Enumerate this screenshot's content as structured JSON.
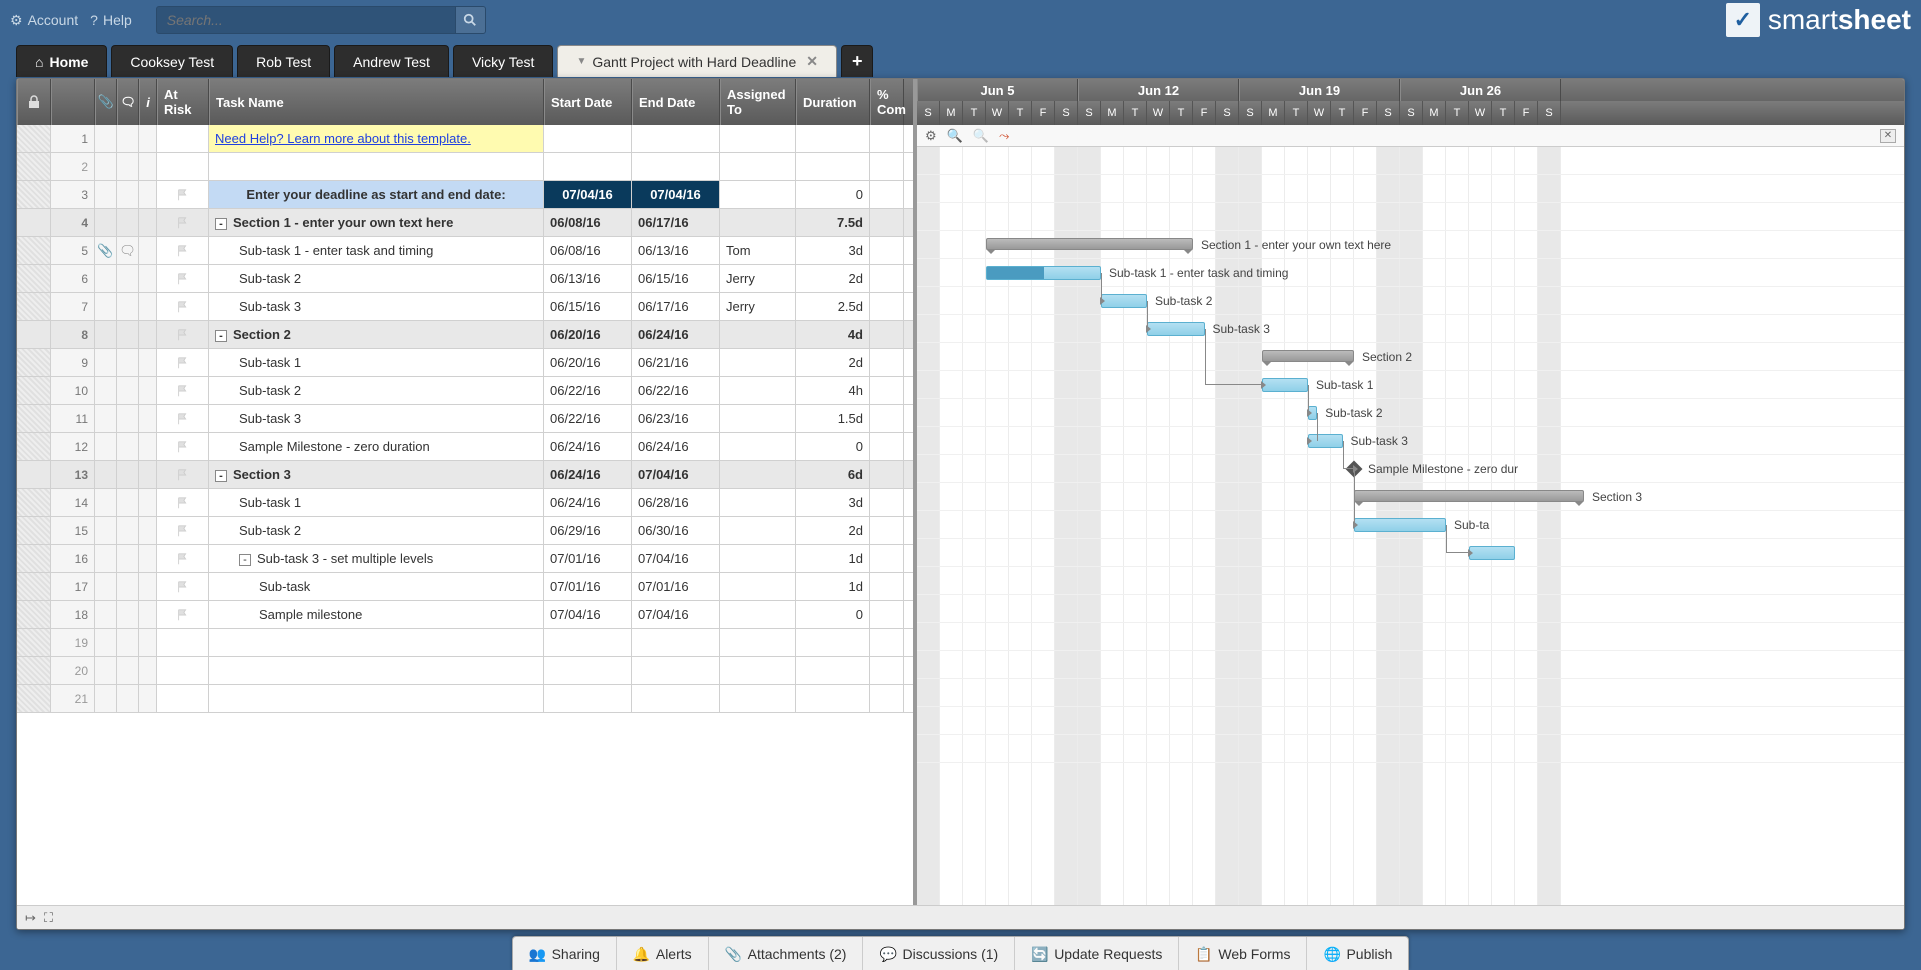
{
  "topbar": {
    "account": "Account",
    "help": "Help",
    "search_placeholder": "Search..."
  },
  "logo": {
    "text1": "smart",
    "text2": "sheet"
  },
  "tabs": {
    "home": "Home",
    "items": [
      "Cooksey Test",
      "Rob Test",
      "Andrew Test",
      "Vicky Test"
    ],
    "active": "Gantt Project with Hard Deadline"
  },
  "columns": {
    "at_risk": "At Risk",
    "task_name": "Task Name",
    "start_date": "Start Date",
    "end_date": "End Date",
    "assigned_to": "Assigned To",
    "duration": "Duration",
    "pct_complete": "% Com"
  },
  "gantt_header": {
    "weeks": [
      "Jun 5",
      "Jun 12",
      "Jun 19",
      "Jun 26"
    ],
    "days": [
      "S",
      "M",
      "T",
      "W",
      "T",
      "F",
      "S"
    ]
  },
  "rows": [
    {
      "num": 1,
      "type": "help",
      "task": "Need Help? Learn more about this template."
    },
    {
      "num": 2,
      "type": "empty"
    },
    {
      "num": 3,
      "type": "deadline",
      "task": "Enter your deadline as start and end date:",
      "start": "07/04/16",
      "end": "07/04/16",
      "duration": "0",
      "flag": true
    },
    {
      "num": 4,
      "type": "section",
      "task": "Section 1 - enter your own text here",
      "start": "06/08/16",
      "end": "06/17/16",
      "duration": "7.5d",
      "expander": "-"
    },
    {
      "num": 5,
      "type": "task",
      "indent": 1,
      "task": "Sub-task 1 - enter task and timing",
      "start": "06/08/16",
      "end": "06/13/16",
      "assigned": "Tom",
      "duration": "3d",
      "flag": true,
      "clip": true,
      "comment": true
    },
    {
      "num": 6,
      "type": "task",
      "indent": 1,
      "task": "Sub-task 2",
      "start": "06/13/16",
      "end": "06/15/16",
      "assigned": "Jerry",
      "duration": "2d",
      "flag": true
    },
    {
      "num": 7,
      "type": "task",
      "indent": 1,
      "task": "Sub-task 3",
      "start": "06/15/16",
      "end": "06/17/16",
      "assigned": "Jerry",
      "duration": "2.5d",
      "flag": true
    },
    {
      "num": 8,
      "type": "section",
      "task": "Section 2",
      "start": "06/20/16",
      "end": "06/24/16",
      "duration": "4d",
      "expander": "-"
    },
    {
      "num": 9,
      "type": "task",
      "indent": 1,
      "task": "Sub-task 1",
      "start": "06/20/16",
      "end": "06/21/16",
      "duration": "2d",
      "flag": true
    },
    {
      "num": 10,
      "type": "task",
      "indent": 1,
      "task": "Sub-task 2",
      "start": "06/22/16",
      "end": "06/22/16",
      "duration": "4h",
      "flag": true
    },
    {
      "num": 11,
      "type": "task",
      "indent": 1,
      "task": "Sub-task 3",
      "start": "06/22/16",
      "end": "06/23/16",
      "duration": "1.5d",
      "flag": true
    },
    {
      "num": 12,
      "type": "task",
      "indent": 1,
      "task": "Sample Milestone - zero duration",
      "start": "06/24/16",
      "end": "06/24/16",
      "duration": "0",
      "flag": true
    },
    {
      "num": 13,
      "type": "section",
      "task": "Section 3",
      "start": "06/24/16",
      "end": "07/04/16",
      "duration": "6d",
      "expander": "-"
    },
    {
      "num": 14,
      "type": "task",
      "indent": 1,
      "task": "Sub-task 1",
      "start": "06/24/16",
      "end": "06/28/16",
      "duration": "3d",
      "flag": true
    },
    {
      "num": 15,
      "type": "task",
      "indent": 1,
      "task": "Sub-task 2",
      "start": "06/29/16",
      "end": "06/30/16",
      "duration": "2d",
      "flag": true
    },
    {
      "num": 16,
      "type": "task",
      "indent": 1,
      "task": "Sub-task 3 - set multiple levels",
      "start": "07/01/16",
      "end": "07/04/16",
      "duration": "1d",
      "flag": true,
      "expander": "-"
    },
    {
      "num": 17,
      "type": "task",
      "indent": 2,
      "task": "Sub-task",
      "start": "07/01/16",
      "end": "07/01/16",
      "duration": "1d",
      "flag": true
    },
    {
      "num": 18,
      "type": "task",
      "indent": 2,
      "task": "Sample milestone",
      "start": "07/04/16",
      "end": "07/04/16",
      "duration": "0",
      "flag": true
    },
    {
      "num": 19,
      "type": "empty"
    },
    {
      "num": 20,
      "type": "empty"
    },
    {
      "num": 21,
      "type": "empty"
    }
  ],
  "gantt_bars": [
    {
      "row": 4,
      "type": "parent",
      "startDay": 3,
      "endDay": 12,
      "label": "Section 1 - enter your own text here"
    },
    {
      "row": 5,
      "type": "task",
      "startDay": 3,
      "endDay": 8,
      "label": "Sub-task 1 - enter task and timing",
      "progress": 50
    },
    {
      "row": 6,
      "type": "task",
      "startDay": 8,
      "endDay": 10,
      "label": "Sub-task 2"
    },
    {
      "row": 7,
      "type": "task",
      "startDay": 10,
      "endDay": 12.5,
      "label": "Sub-task 3"
    },
    {
      "row": 8,
      "type": "parent",
      "startDay": 15,
      "endDay": 19,
      "label": "Section 2"
    },
    {
      "row": 9,
      "type": "task",
      "startDay": 15,
      "endDay": 17,
      "label": "Sub-task 1"
    },
    {
      "row": 10,
      "type": "task",
      "startDay": 17,
      "endDay": 17.4,
      "label": "Sub-task 2"
    },
    {
      "row": 11,
      "type": "task",
      "startDay": 17,
      "endDay": 18.5,
      "label": "Sub-task 3"
    },
    {
      "row": 12,
      "type": "milestone",
      "startDay": 19,
      "label": "Sample Milestone - zero dur"
    },
    {
      "row": 13,
      "type": "parent",
      "startDay": 19,
      "endDay": 29,
      "label": "Section 3"
    },
    {
      "row": 14,
      "type": "task",
      "startDay": 19,
      "endDay": 23,
      "label": "Sub-ta"
    },
    {
      "row": 15,
      "type": "task",
      "startDay": 24,
      "endDay": 26,
      "label": ""
    }
  ],
  "dependencies": [
    {
      "fromRow": 5,
      "fromDay": 8,
      "toRow": 6,
      "toDay": 8
    },
    {
      "fromRow": 6,
      "fromDay": 10,
      "toRow": 7,
      "toDay": 10
    },
    {
      "fromRow": 7,
      "fromDay": 12.5,
      "toRow": 9,
      "toDay": 15
    },
    {
      "fromRow": 9,
      "fromDay": 17,
      "toRow": 10,
      "toDay": 17
    },
    {
      "fromRow": 10,
      "fromDay": 17.4,
      "toRow": 11,
      "toDay": 17
    },
    {
      "fromRow": 11,
      "fromDay": 18.5,
      "toRow": 12,
      "toDay": 19
    },
    {
      "fromRow": 12,
      "fromDay": 19,
      "toRow": 14,
      "toDay": 19
    },
    {
      "fromRow": 14,
      "fromDay": 23,
      "toRow": 15,
      "toDay": 24
    }
  ],
  "bottombar": {
    "sharing": "Sharing",
    "alerts": "Alerts",
    "attachments": "Attachments  (2)",
    "discussions": "Discussions  (1)",
    "update_requests": "Update Requests",
    "web_forms": "Web Forms",
    "publish": "Publish"
  }
}
